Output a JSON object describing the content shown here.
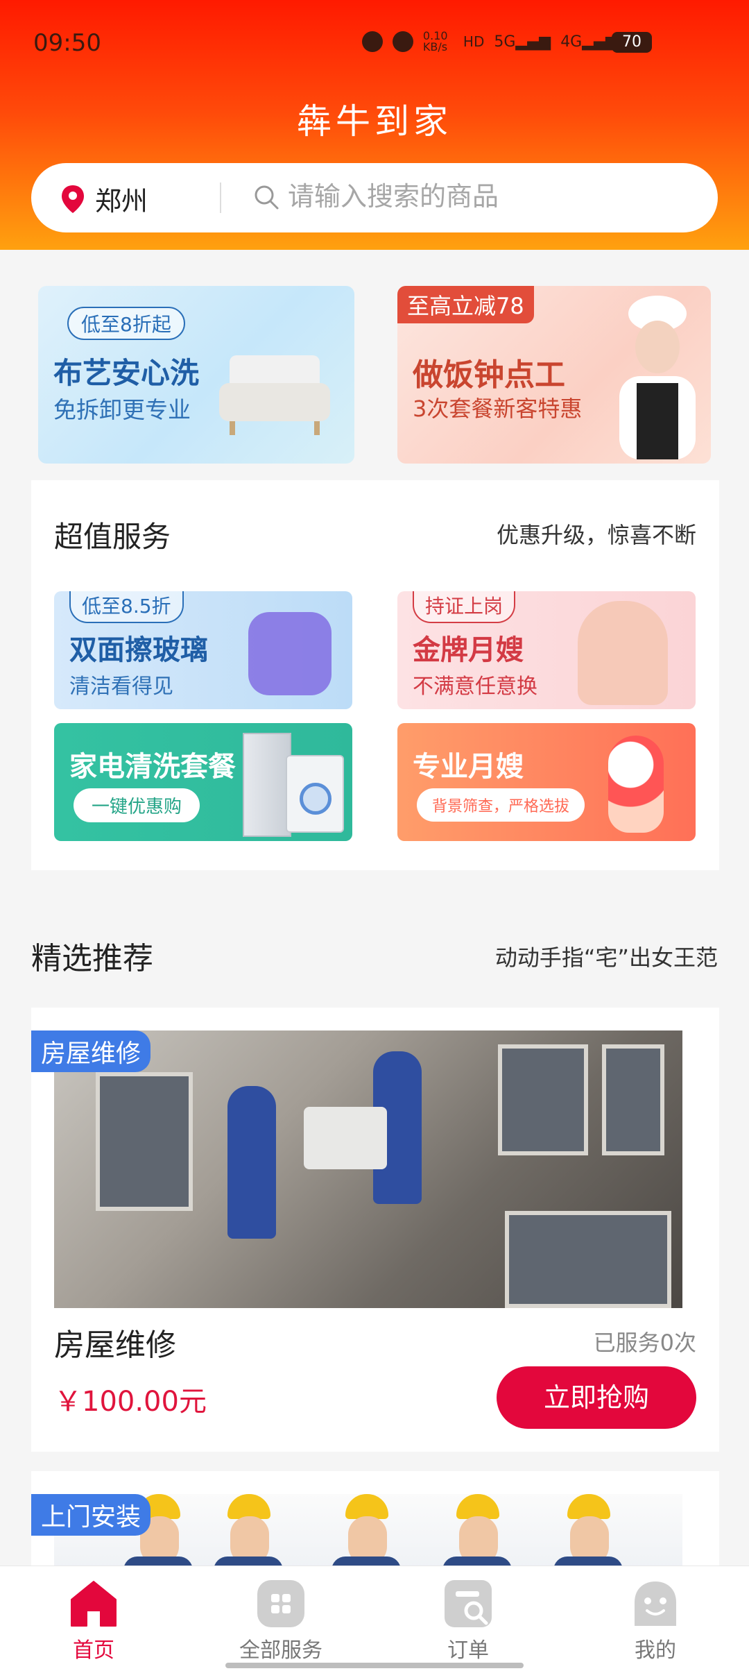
{
  "status_bar": {
    "time": "09:50",
    "net_speed": "0.10 KB/s",
    "battery": "70"
  },
  "header": {
    "title": "犇牛到家",
    "location": "郑州",
    "search_placeholder": "请输入搜索的商品"
  },
  "banners": [
    {
      "tag": "低至8折起",
      "title": "布艺安心洗",
      "subtitle": "免拆卸更专业"
    },
    {
      "tag": "至高立减78",
      "title": "做饭钟点工",
      "subtitle": "3次套餐新客特惠"
    }
  ],
  "value_services": {
    "title": "超值服务",
    "slogan": "优惠升级，惊喜不断",
    "tiles": [
      {
        "tag": "低至8.5折",
        "title": "双面擦玻璃",
        "subtitle": "清洁看得见"
      },
      {
        "tag": "持证上岗",
        "title": "金牌月嫂",
        "subtitle": "不满意任意换"
      },
      {
        "title": "家电清洗套餐",
        "button": "一键优惠购"
      },
      {
        "title": "专业月嫂",
        "button": "背景筛查，严格选拔"
      }
    ]
  },
  "featured": {
    "title": "精选推荐",
    "slogan": "动动手指“宅”出女王范",
    "products": [
      {
        "category": "房屋维修",
        "name": "房屋维修",
        "served": "已服务0次",
        "price": "￥100.00元",
        "buy_label": "立即抢购"
      },
      {
        "category": "上门安装"
      }
    ]
  },
  "bottom_nav": [
    {
      "label": "首页",
      "icon": "home-icon",
      "active": true
    },
    {
      "label": "全部服务",
      "icon": "grid-icon",
      "active": false
    },
    {
      "label": "订单",
      "icon": "order-icon",
      "active": false
    },
    {
      "label": "我的",
      "icon": "profile-icon",
      "active": false
    }
  ],
  "colors": {
    "brand_red": "#e3073c",
    "header_top": "#ff1a00",
    "header_bottom": "#ffa10f",
    "badge_blue": "#3f7be6"
  }
}
